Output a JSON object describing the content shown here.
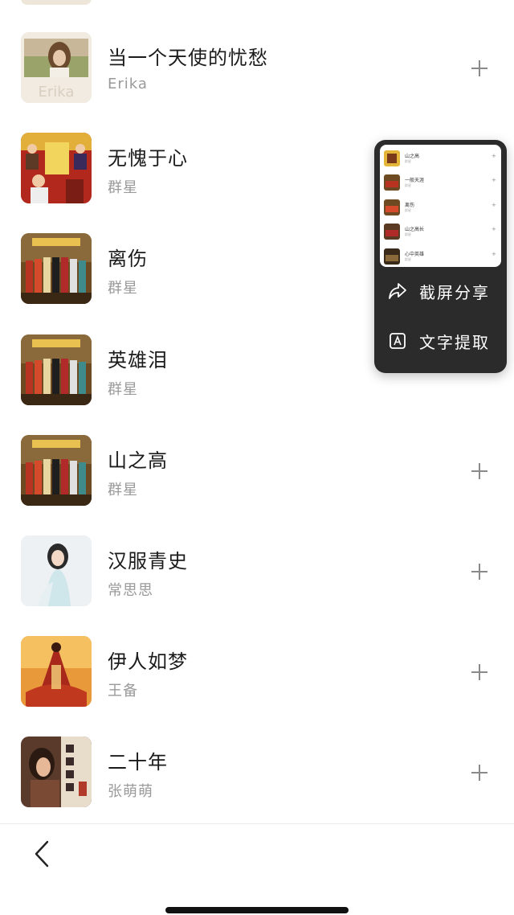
{
  "songs": [
    {
      "title": "当一个天使的忧愁",
      "artist": "Erika",
      "cover_text": "Erika",
      "cover_style": "light"
    },
    {
      "title": "无愧于心",
      "artist": "群星",
      "cover_style": "red"
    },
    {
      "title": "离伤",
      "artist": "群星",
      "cover_style": "crowd"
    },
    {
      "title": "英雄泪",
      "artist": "群星",
      "cover_style": "crowd"
    },
    {
      "title": "山之高",
      "artist": "群星",
      "cover_style": "crowd"
    },
    {
      "title": "汉服青史",
      "artist": "常思思",
      "cover_style": "portrait-light"
    },
    {
      "title": "伊人如梦",
      "artist": "王备",
      "cover_style": "orange"
    },
    {
      "title": "二十年",
      "artist": "张萌萌",
      "cover_style": "dark-portrait"
    }
  ],
  "popup": {
    "share_label": "截屏分享",
    "extract_label": "文字提取",
    "thumbnail_rows": [
      {
        "title": "山之高",
        "artist": "群星",
        "cover_style": "yellow"
      },
      {
        "title": "一般天涯",
        "artist": "群星",
        "cover_style": "crowd"
      },
      {
        "title": "离伤",
        "artist": "群星",
        "cover_style": "crowd"
      },
      {
        "title": "山之高长",
        "artist": "群星",
        "cover_style": "crowd"
      },
      {
        "title": "心中英雄",
        "artist": "群星",
        "cover_style": "crowd"
      }
    ]
  },
  "icons": {
    "add": "plus-icon",
    "back": "chevron-left-icon",
    "share": "share-arrow-icon",
    "extract": "text-extract-icon"
  },
  "colors": {
    "title": "#1b1b1b",
    "artist": "#9a9a9a",
    "popup_bg": "#2b2b2b",
    "popup_text": "#ffffff"
  }
}
